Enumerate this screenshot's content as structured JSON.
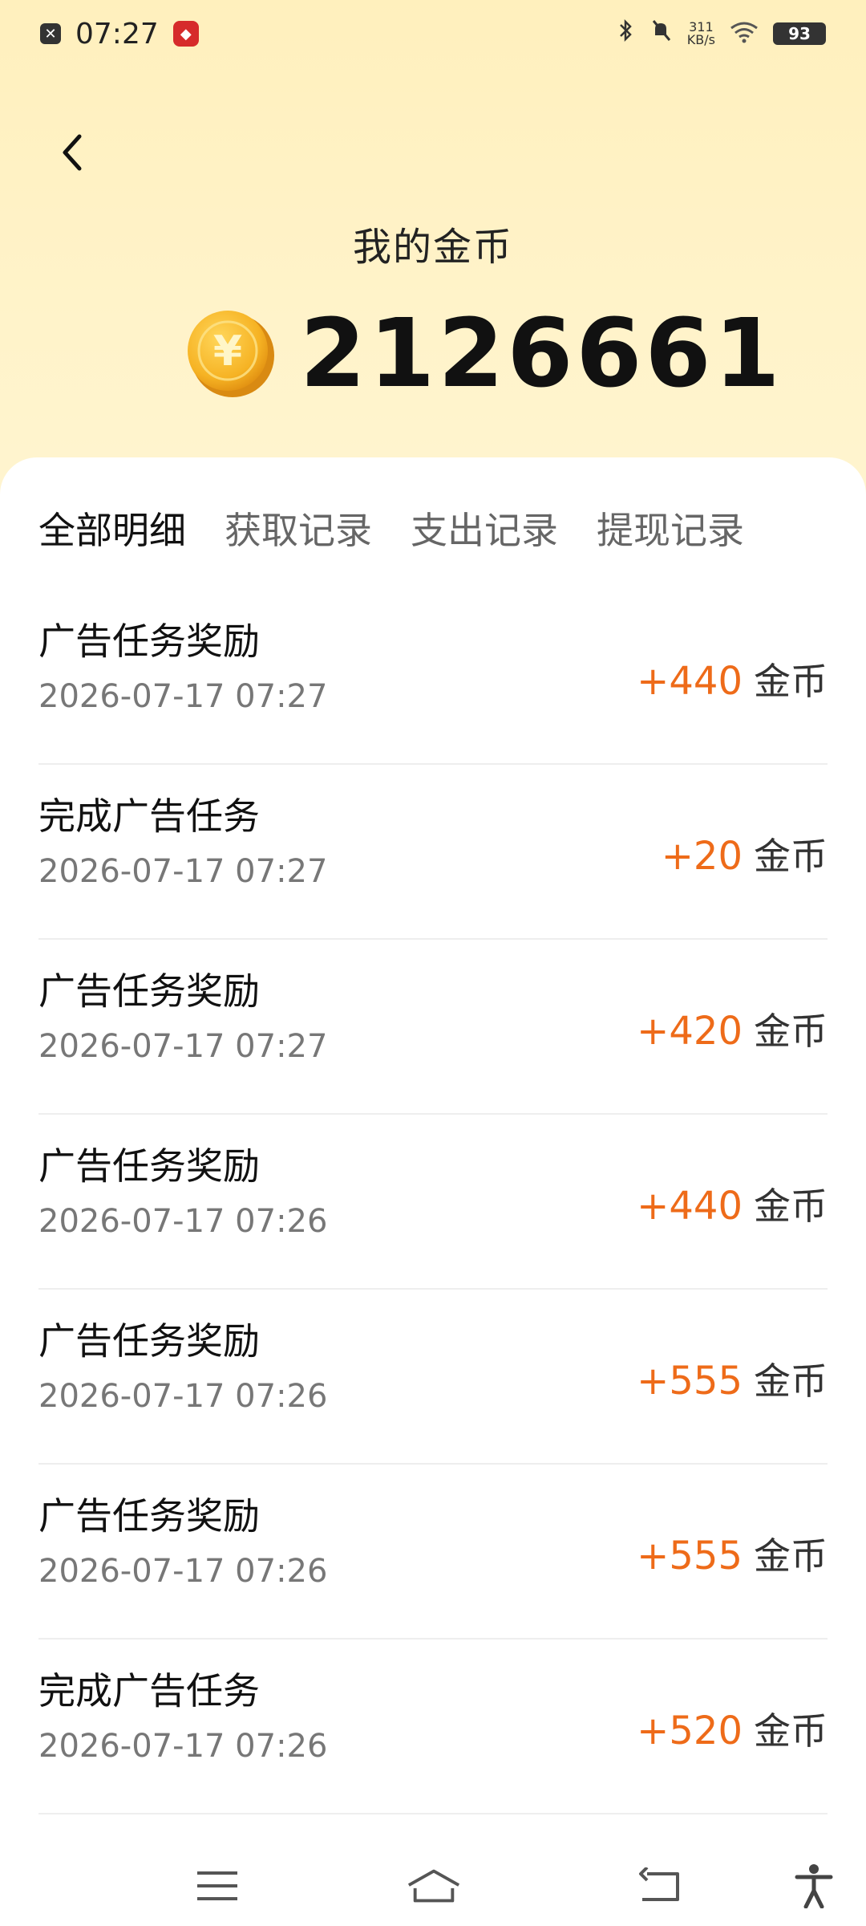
{
  "status_bar": {
    "time": "07:27",
    "speed_value": "311",
    "speed_unit": "KB/s",
    "battery": "93"
  },
  "header": {
    "title": "我的金币",
    "balance": "2126661"
  },
  "tabs": [
    "全部明细",
    "获取记录",
    "支出记录",
    "提现记录"
  ],
  "records": [
    {
      "title": "广告任务奖励",
      "time": "2026-07-17 07:27",
      "amount": "+440",
      "unit": "金币"
    },
    {
      "title": "完成广告任务",
      "time": "2026-07-17 07:27",
      "amount": "+20",
      "unit": "金币"
    },
    {
      "title": "广告任务奖励",
      "time": "2026-07-17 07:27",
      "amount": "+420",
      "unit": "金币"
    },
    {
      "title": "广告任务奖励",
      "time": "2026-07-17 07:26",
      "amount": "+440",
      "unit": "金币"
    },
    {
      "title": "广告任务奖励",
      "time": "2026-07-17 07:26",
      "amount": "+555",
      "unit": "金币"
    },
    {
      "title": "广告任务奖励",
      "time": "2026-07-17 07:26",
      "amount": "+555",
      "unit": "金币"
    },
    {
      "title": "完成广告任务",
      "time": "2026-07-17 07:26",
      "amount": "+520",
      "unit": "金币"
    }
  ],
  "colors": {
    "accent_orange": "#ee6b19",
    "header_bg": "#fff3c9",
    "coin": "#f6b324"
  },
  "icons": {
    "back": "chevron-left-icon",
    "coin": "yuan-coin-icon",
    "menu": "menu-icon",
    "home": "home-icon",
    "back_nav": "back-arrow-icon",
    "accessibility": "accessibility-icon"
  }
}
